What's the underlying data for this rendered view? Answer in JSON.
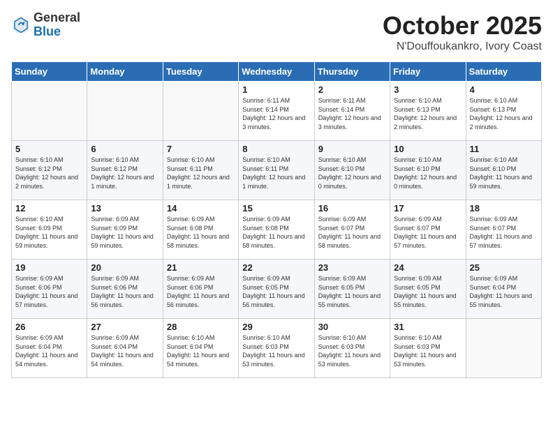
{
  "logo": {
    "general": "General",
    "blue": "Blue"
  },
  "header": {
    "month": "October 2025",
    "location": "N'Douffoukankro, Ivory Coast"
  },
  "weekdays": [
    "Sunday",
    "Monday",
    "Tuesday",
    "Wednesday",
    "Thursday",
    "Friday",
    "Saturday"
  ],
  "weeks": [
    [
      {
        "day": "",
        "info": ""
      },
      {
        "day": "",
        "info": ""
      },
      {
        "day": "",
        "info": ""
      },
      {
        "day": "1",
        "info": "Sunrise: 6:11 AM\nSunset: 6:14 PM\nDaylight: 12 hours and 3 minutes."
      },
      {
        "day": "2",
        "info": "Sunrise: 6:11 AM\nSunset: 6:14 PM\nDaylight: 12 hours and 3 minutes."
      },
      {
        "day": "3",
        "info": "Sunrise: 6:10 AM\nSunset: 6:13 PM\nDaylight: 12 hours and 2 minutes."
      },
      {
        "day": "4",
        "info": "Sunrise: 6:10 AM\nSunset: 6:13 PM\nDaylight: 12 hours and 2 minutes."
      }
    ],
    [
      {
        "day": "5",
        "info": "Sunrise: 6:10 AM\nSunset: 6:12 PM\nDaylight: 12 hours and 2 minutes."
      },
      {
        "day": "6",
        "info": "Sunrise: 6:10 AM\nSunset: 6:12 PM\nDaylight: 12 hours and 1 minute."
      },
      {
        "day": "7",
        "info": "Sunrise: 6:10 AM\nSunset: 6:11 PM\nDaylight: 12 hours and 1 minute."
      },
      {
        "day": "8",
        "info": "Sunrise: 6:10 AM\nSunset: 6:11 PM\nDaylight: 12 hours and 1 minute."
      },
      {
        "day": "9",
        "info": "Sunrise: 6:10 AM\nSunset: 6:10 PM\nDaylight: 12 hours and 0 minutes."
      },
      {
        "day": "10",
        "info": "Sunrise: 6:10 AM\nSunset: 6:10 PM\nDaylight: 12 hours and 0 minutes."
      },
      {
        "day": "11",
        "info": "Sunrise: 6:10 AM\nSunset: 6:10 PM\nDaylight: 11 hours and 59 minutes."
      }
    ],
    [
      {
        "day": "12",
        "info": "Sunrise: 6:10 AM\nSunset: 6:09 PM\nDaylight: 11 hours and 59 minutes."
      },
      {
        "day": "13",
        "info": "Sunrise: 6:09 AM\nSunset: 6:09 PM\nDaylight: 11 hours and 59 minutes."
      },
      {
        "day": "14",
        "info": "Sunrise: 6:09 AM\nSunset: 6:08 PM\nDaylight: 11 hours and 58 minutes."
      },
      {
        "day": "15",
        "info": "Sunrise: 6:09 AM\nSunset: 6:08 PM\nDaylight: 11 hours and 58 minutes."
      },
      {
        "day": "16",
        "info": "Sunrise: 6:09 AM\nSunset: 6:07 PM\nDaylight: 11 hours and 58 minutes."
      },
      {
        "day": "17",
        "info": "Sunrise: 6:09 AM\nSunset: 6:07 PM\nDaylight: 11 hours and 57 minutes."
      },
      {
        "day": "18",
        "info": "Sunrise: 6:09 AM\nSunset: 6:07 PM\nDaylight: 11 hours and 57 minutes."
      }
    ],
    [
      {
        "day": "19",
        "info": "Sunrise: 6:09 AM\nSunset: 6:06 PM\nDaylight: 11 hours and 57 minutes."
      },
      {
        "day": "20",
        "info": "Sunrise: 6:09 AM\nSunset: 6:06 PM\nDaylight: 11 hours and 56 minutes."
      },
      {
        "day": "21",
        "info": "Sunrise: 6:09 AM\nSunset: 6:06 PM\nDaylight: 11 hours and 56 minutes."
      },
      {
        "day": "22",
        "info": "Sunrise: 6:09 AM\nSunset: 6:05 PM\nDaylight: 11 hours and 56 minutes."
      },
      {
        "day": "23",
        "info": "Sunrise: 6:09 AM\nSunset: 6:05 PM\nDaylight: 11 hours and 55 minutes."
      },
      {
        "day": "24",
        "info": "Sunrise: 6:09 AM\nSunset: 6:05 PM\nDaylight: 11 hours and 55 minutes."
      },
      {
        "day": "25",
        "info": "Sunrise: 6:09 AM\nSunset: 6:04 PM\nDaylight: 11 hours and 55 minutes."
      }
    ],
    [
      {
        "day": "26",
        "info": "Sunrise: 6:09 AM\nSunset: 6:04 PM\nDaylight: 11 hours and 54 minutes."
      },
      {
        "day": "27",
        "info": "Sunrise: 6:09 AM\nSunset: 6:04 PM\nDaylight: 11 hours and 54 minutes."
      },
      {
        "day": "28",
        "info": "Sunrise: 6:10 AM\nSunset: 6:04 PM\nDaylight: 11 hours and 54 minutes."
      },
      {
        "day": "29",
        "info": "Sunrise: 6:10 AM\nSunset: 6:03 PM\nDaylight: 11 hours and 53 minutes."
      },
      {
        "day": "30",
        "info": "Sunrise: 6:10 AM\nSunset: 6:03 PM\nDaylight: 11 hours and 53 minutes."
      },
      {
        "day": "31",
        "info": "Sunrise: 6:10 AM\nSunset: 6:03 PM\nDaylight: 11 hours and 53 minutes."
      },
      {
        "day": "",
        "info": ""
      }
    ]
  ]
}
